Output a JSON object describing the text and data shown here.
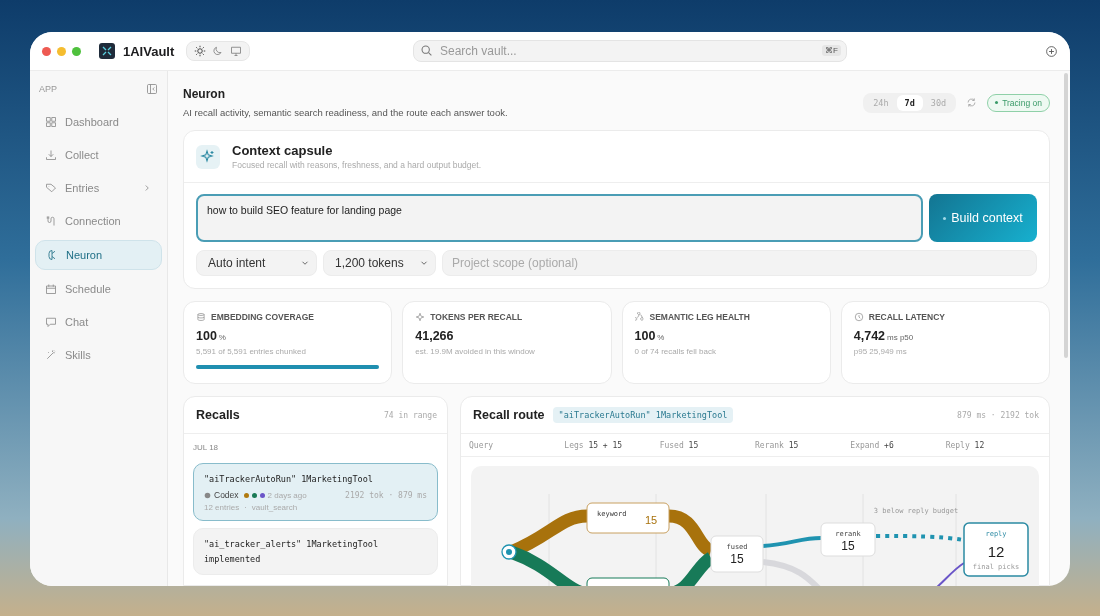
{
  "window": {
    "app_name": "1AIVault",
    "theme_modes": [
      {
        "kind": "light",
        "selected": true
      },
      {
        "kind": "dark",
        "selected": false
      },
      {
        "kind": "system",
        "selected": false
      }
    ]
  },
  "search": {
    "placeholder": "Search vault...",
    "shortcut": "⌘F"
  },
  "sidebar": {
    "section": "APP",
    "items": [
      {
        "label": "Dashboard",
        "selected": false,
        "has_children": false
      },
      {
        "label": "Collect",
        "selected": false,
        "has_children": false
      },
      {
        "label": "Entries",
        "selected": false,
        "has_children": true
      },
      {
        "label": "Connection",
        "selected": false,
        "has_children": false
      },
      {
        "label": "Neuron",
        "selected": true,
        "has_children": false
      },
      {
        "label": "Schedule",
        "selected": false,
        "has_children": false
      },
      {
        "label": "Chat",
        "selected": false,
        "has_children": false
      },
      {
        "label": "Skills",
        "selected": false,
        "has_children": false
      }
    ]
  },
  "header": {
    "title": "Neuron",
    "subtitle": "AI recall activity, semantic search readiness, and the route each answer took.",
    "ranges": [
      {
        "label": "24h",
        "selected": false
      },
      {
        "label": "7d",
        "selected": true
      },
      {
        "label": "30d",
        "selected": false
      }
    ],
    "tracing": {
      "label": "Tracing on",
      "on": true
    }
  },
  "capsule": {
    "title": "Context capsule",
    "subtitle": "Focused recall with reasons, freshness, and a hard output budget.",
    "query": "how to build SEO feature for landing page",
    "build_button": "Build context",
    "intent": "Auto intent",
    "tokens": "1,200 tokens",
    "scope_placeholder": "Project scope (optional)"
  },
  "stats": [
    {
      "label": "EMBEDDING COVERAGE",
      "value": "100",
      "unit": "%",
      "note": "5,591 of 5,591 entries chunked",
      "level": 1.0
    },
    {
      "label": "TOKENS PER RECALL",
      "value": "41,266",
      "note": "est. 19.9M avoided in this window"
    },
    {
      "label": "SEMANTIC LEG HEALTH",
      "value": "100",
      "unit": "%",
      "note": "0 of 74 recalls fell back"
    },
    {
      "label": "RECALL LATENCY",
      "value": "4,742",
      "unit": "ms p50",
      "note": "p95 25,949 ms"
    }
  ],
  "recalls": {
    "title": "Recalls",
    "count": "74 in range",
    "group": "JUL 18",
    "items": [
      {
        "title": "\"aiTrackerAutoRun\" 1MarketingTool",
        "selected": true,
        "agent": "Codex",
        "sources": [
          {
            "color": "#b07a10"
          },
          {
            "color": "#1a7a55"
          },
          {
            "color": "#6a55c8"
          }
        ],
        "time": "2 days ago",
        "usage": "2192 tok · 879 ms",
        "entries": "12 entries",
        "separator": "·",
        "tool": "vault_search"
      },
      {
        "title": "\"ai_tracker_alerts\" 1MarketingTool implemented",
        "selected": false
      }
    ]
  },
  "route": {
    "title": "Recall route",
    "chip": "\"aiTrackerAutoRun\" 1MarketingTool",
    "summary": "879 ms · 2192 tok",
    "stages": [
      {
        "label": "Query"
      },
      {
        "label": "Legs",
        "value": "15 + 15"
      },
      {
        "label": "Fused",
        "value": "15"
      },
      {
        "label": "Rerank",
        "value": "15"
      },
      {
        "label": "Expand",
        "value": "+6"
      },
      {
        "label": "Reply",
        "value": "12"
      }
    ],
    "nodes": [
      {
        "kind": "keyword",
        "label": "keyword",
        "value": "15"
      },
      {
        "kind": "fused",
        "label": "fused",
        "value": "15"
      },
      {
        "kind": "rerank",
        "label": "rerank",
        "value": "15"
      },
      {
        "kind": "reply",
        "label": "reply",
        "value": "12",
        "note": "final picks"
      }
    ],
    "budget_note": "3 below reply budget"
  }
}
